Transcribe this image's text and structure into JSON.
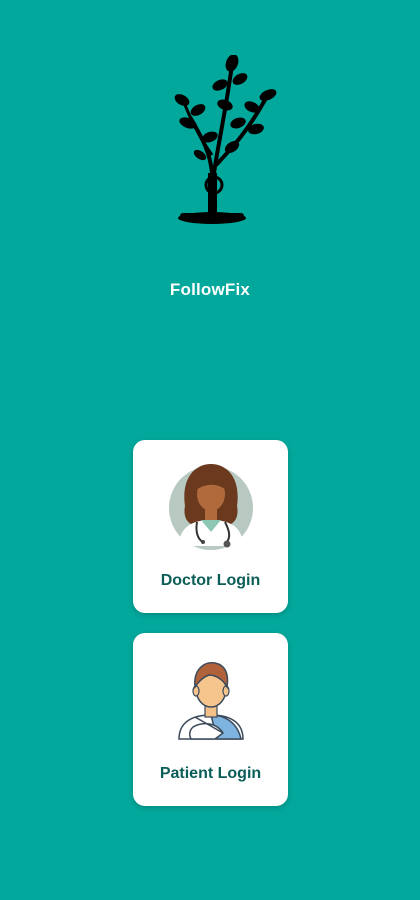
{
  "app": {
    "name": "FollowFix"
  },
  "cards": {
    "doctor_label": "Doctor Login",
    "patient_label": "Patient Login"
  },
  "colors": {
    "background": "#03a89c",
    "card": "#ffffff",
    "label_text": "#0b5e57"
  },
  "icons": {
    "logo": "tree-logo-icon",
    "doctor": "doctor-avatar-icon",
    "patient": "patient-avatar-icon"
  }
}
